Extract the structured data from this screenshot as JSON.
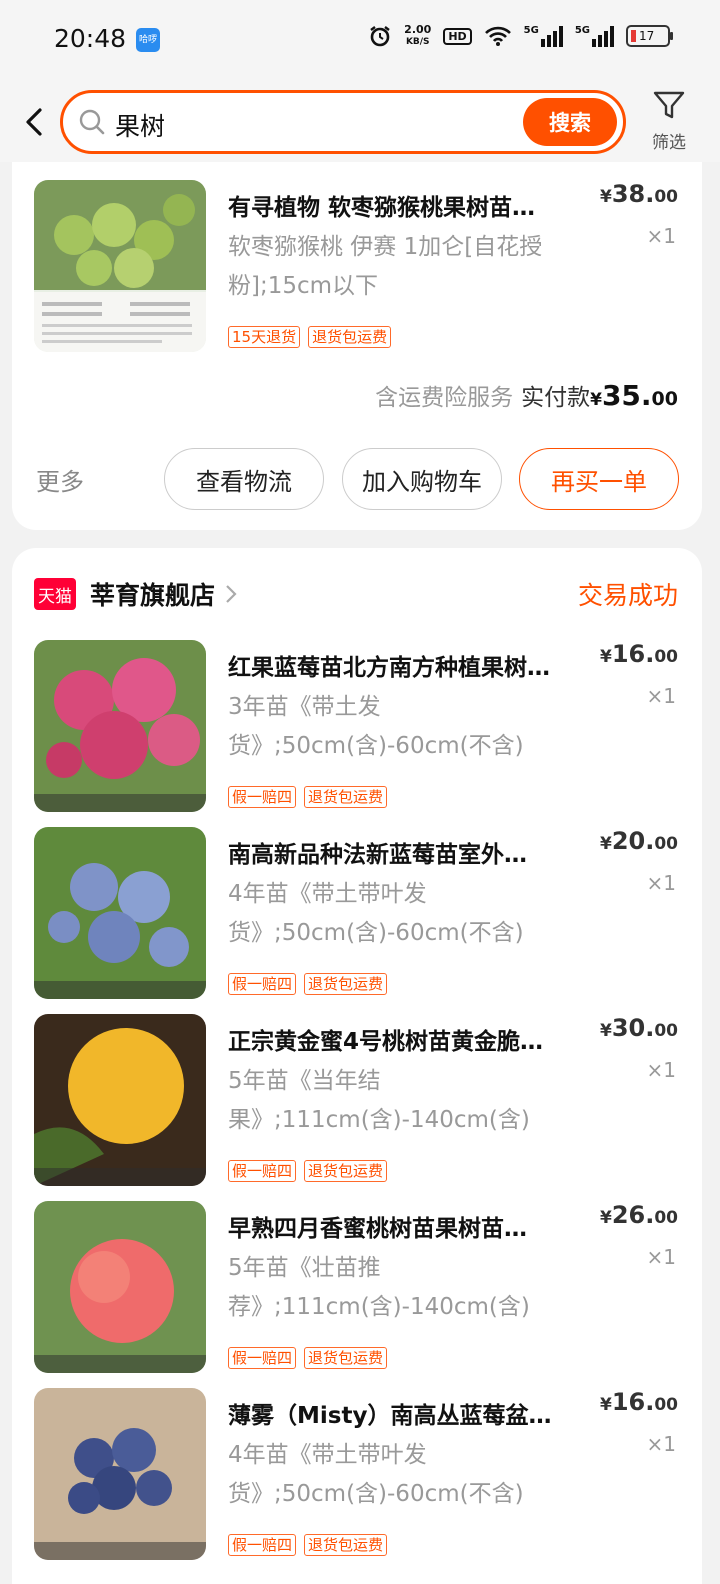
{
  "status_bar": {
    "time": "20:48",
    "app_badge": "哈啰",
    "net_speed_value": "2.00",
    "net_speed_unit": "KB/S",
    "hd": "HD",
    "sig1": "5G",
    "sig2": "5G",
    "battery": "17"
  },
  "search": {
    "query": "果树",
    "button": "搜索",
    "filter_label": "筛选"
  },
  "order1": {
    "item": {
      "title": "有寻植物 软枣猕猴桃果树苗…",
      "spec": "软枣猕猴桃 伊赛 1加仑[自花授粉];15cm以下",
      "tags": [
        "15天退货",
        "退货包运费"
      ],
      "price_cur": "¥",
      "price_int": "38.",
      "price_dec": "00",
      "qty": "×1"
    },
    "insurance": "含运费险服务",
    "paid_label": "实付款",
    "paid_cur": "¥",
    "paid_int": "35.",
    "paid_dec": "00",
    "more": "更多",
    "btn_logistics": "查看物流",
    "btn_cart": "加入购物车",
    "btn_rebuy": "再买一单"
  },
  "order2": {
    "tmall": "天猫",
    "shop_name": "莘育旗舰店",
    "status": "交易成功",
    "items": [
      {
        "title": "红果蓝莓苗北方南方种植果树…",
        "spec": "3年苗《带土发货》;50cm(含)-60cm(不含)",
        "tags": [
          "假一赔四",
          "退货包运费"
        ],
        "price_cur": "¥",
        "price_int": "16.",
        "price_dec": "00",
        "qty": "×1"
      },
      {
        "title": "南高新品种法新蓝莓苗室外…",
        "spec": "4年苗《带土带叶发货》;50cm(含)-60cm(不含)",
        "tags": [
          "假一赔四",
          "退货包运费"
        ],
        "price_cur": "¥",
        "price_int": "20.",
        "price_dec": "00",
        "qty": "×1"
      },
      {
        "title": "正宗黄金蜜4号桃树苗黄金脆…",
        "spec": "5年苗《当年结果》;111cm(含)-140cm(含)",
        "tags": [
          "假一赔四",
          "退货包运费"
        ],
        "price_cur": "¥",
        "price_int": "30.",
        "price_dec": "00",
        "qty": "×1"
      },
      {
        "title": "早熟四月香蜜桃树苗果树苗…",
        "spec": "5年苗《壮苗推荐》;111cm(含)-140cm(含)",
        "tags": [
          "假一赔四",
          "退货包运费"
        ],
        "price_cur": "¥",
        "price_int": "26.",
        "price_dec": "00",
        "qty": "×1"
      },
      {
        "title": "薄雾（Misty）南高丛蓝莓盆…",
        "spec": "4年苗《带土带叶发货》;50cm(含)-60cm(不含)",
        "tags": [
          "假一赔四",
          "退货包运费"
        ],
        "price_cur": "¥",
        "price_int": "16.",
        "price_dec": "00",
        "qty": "×1"
      }
    ]
  },
  "colors": {
    "accent": "#ff5000",
    "tmall": "#ff0036",
    "muted": "#999999"
  }
}
